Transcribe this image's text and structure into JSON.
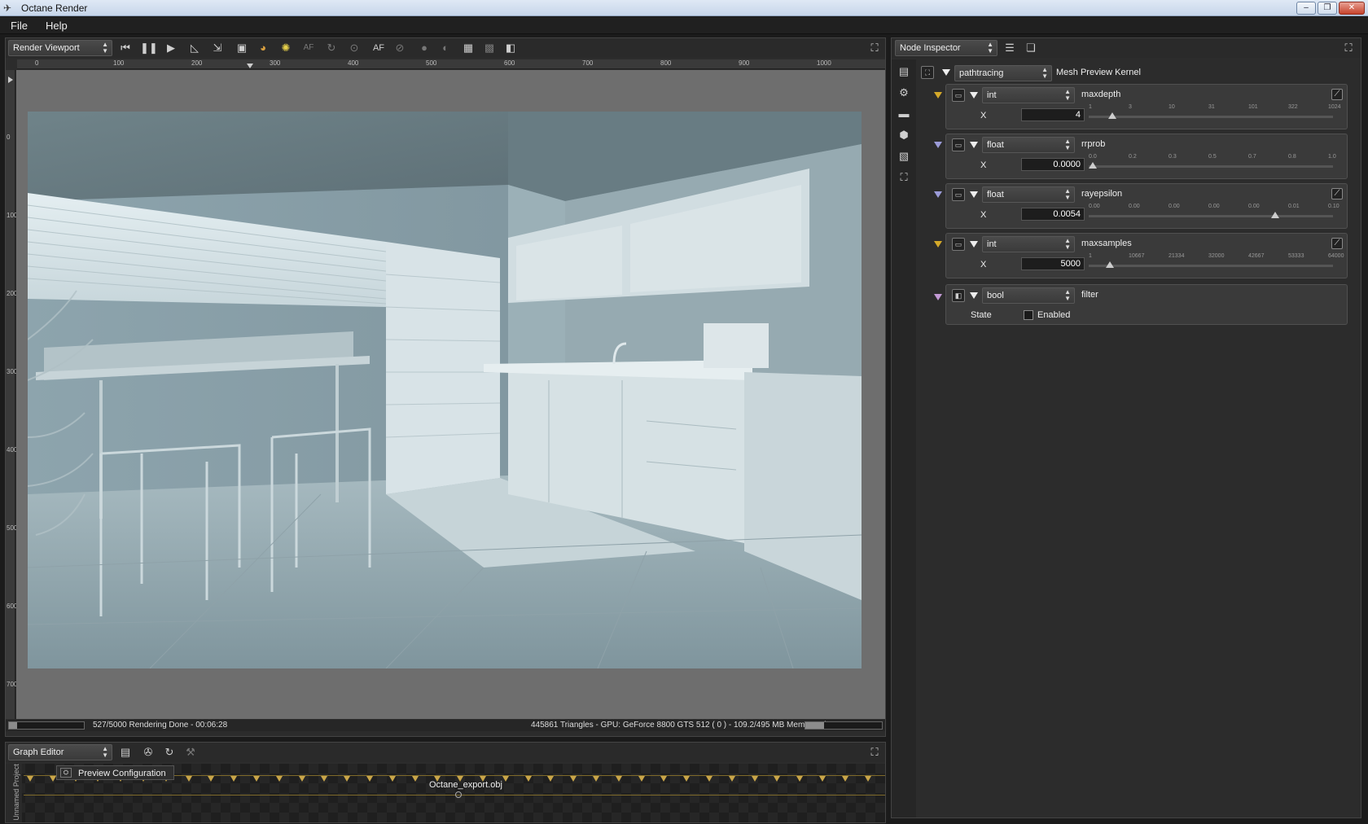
{
  "window": {
    "title": "Octane Render",
    "min": "–",
    "max": "❐",
    "close": "✕"
  },
  "menu": {
    "items": [
      "File",
      "Help"
    ]
  },
  "viewport": {
    "panel_select": "Render Viewport",
    "ruler_x": [
      "0",
      "100",
      "200",
      "300",
      "400",
      "500",
      "600",
      "700",
      "800",
      "900",
      "1000"
    ],
    "ruler_y": [
      "0",
      "100",
      "200",
      "300",
      "400",
      "500",
      "600",
      "700"
    ],
    "status_left": "527/5000 Rendering Done - 00:06:28",
    "status_right": "445861 Triangles - GPU: GeForce 8800 GTS 512 ( 0 ) - 109.2/495 MB Mem Used",
    "progress": 0.1054,
    "tools": [
      "skip-back-icon",
      "pause-icon",
      "play-icon",
      "ruler-icon",
      "fit-icon",
      "region-icon",
      "color-picker-icon",
      "light-icon",
      "af-dim-icon",
      "refresh-dim-icon",
      "focus-dim-icon",
      "autofocus-icon",
      "clay-icon",
      "sphere-icon",
      "sphere2-icon",
      "grid-icon",
      "checker-icon",
      "alpha-icon"
    ],
    "af_label": "AF"
  },
  "inspector": {
    "panel_select": "Node Inspector",
    "kernel_type": "pathtracing",
    "kernel_name": "Mesh Preview Kernel",
    "params": [
      {
        "type": "int",
        "name": "maxdepth",
        "axis": "X",
        "value": "4",
        "ticks": [
          "1",
          "3",
          "10",
          "31",
          "101",
          "322",
          "1024"
        ],
        "pos": 0.08
      },
      {
        "type": "float",
        "name": "rrprob",
        "axis": "X",
        "value": "0.0000",
        "ticks": [
          "0.0",
          "0.2",
          "0.3",
          "0.5",
          "0.7",
          "0.8",
          "1.0"
        ],
        "pos": 0.0
      },
      {
        "type": "float",
        "name": "rayepsilon",
        "axis": "X",
        "value": "0.0054",
        "ticks": [
          "0.00",
          "0.00",
          "0.00",
          "0.00",
          "0.00",
          "0.01",
          "0.10"
        ],
        "pos": 0.76
      },
      {
        "type": "int",
        "name": "maxsamples",
        "axis": "X",
        "value": "5000",
        "ticks": [
          "1",
          "10667",
          "21334",
          "32000",
          "42667",
          "53333",
          "64000"
        ],
        "pos": 0.07
      }
    ],
    "bool_param": {
      "type": "bool",
      "name": "filter",
      "state_label": "State",
      "checkbox_label": "Enabled",
      "checked": false
    }
  },
  "graph": {
    "panel_select": "Graph Editor",
    "project_label": "Unnamed Project",
    "preview_node": "Preview Configuration",
    "mesh_node": "Octane_export.obj"
  }
}
